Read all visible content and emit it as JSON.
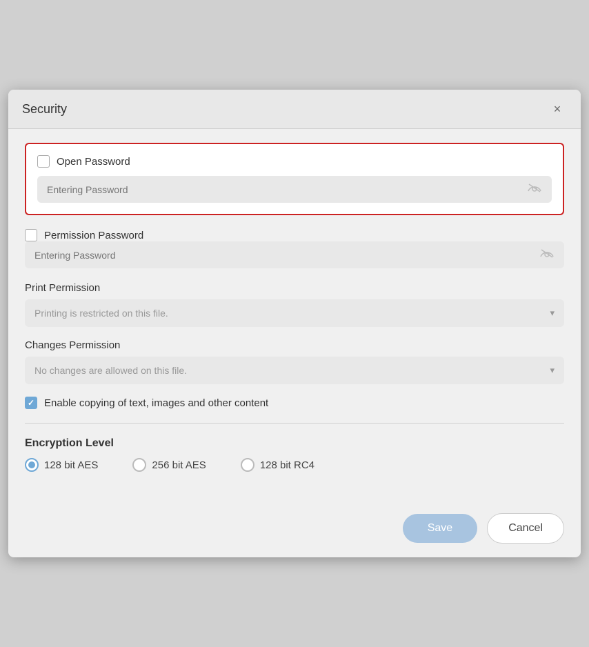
{
  "dialog": {
    "title": "Security",
    "close_label": "×"
  },
  "open_password": {
    "checkbox_label": "Open Password",
    "placeholder": "Entering Password",
    "checked": false
  },
  "permission_password": {
    "checkbox_label": "Permission Password",
    "placeholder": "Entering Password",
    "checked": false
  },
  "print_permission": {
    "label": "Print Permission",
    "dropdown_text": "Printing is restricted on this file.",
    "arrow": "▾"
  },
  "changes_permission": {
    "label": "Changes Permission",
    "dropdown_text": "No changes are allowed on this file.",
    "arrow": "▾"
  },
  "copy_checkbox": {
    "label": "Enable copying of text, images and other content",
    "checked": true
  },
  "encryption": {
    "title": "Encryption Level",
    "options": [
      {
        "label": "128 bit AES",
        "selected": true
      },
      {
        "label": "256 bit AES",
        "selected": false
      },
      {
        "label": "128 bit RC4",
        "selected": false
      }
    ]
  },
  "footer": {
    "save_label": "Save",
    "cancel_label": "Cancel"
  },
  "eye_icon_symbol": "⌒ ⌒"
}
